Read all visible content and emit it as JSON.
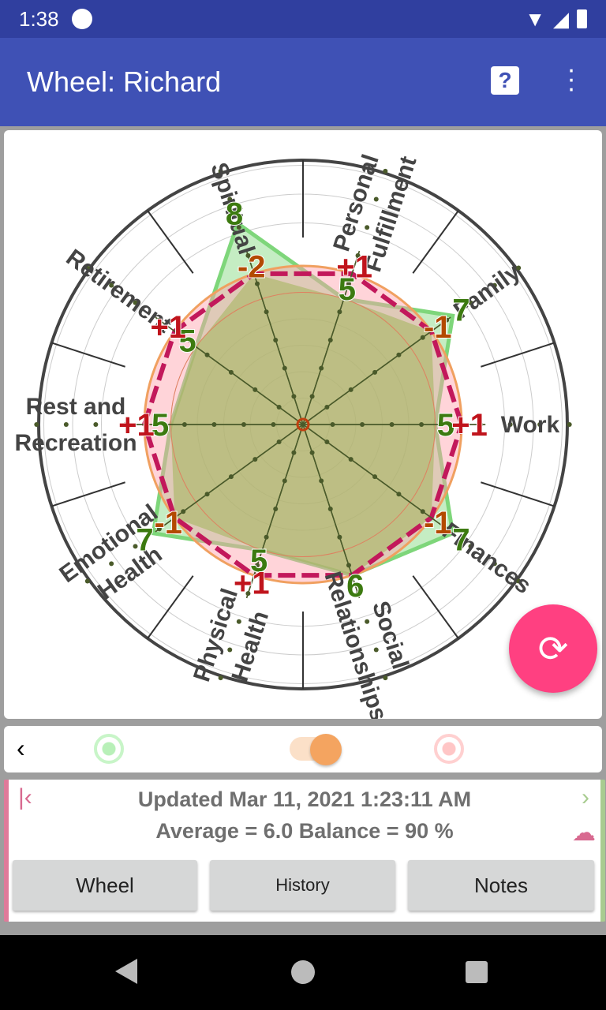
{
  "status_bar": {
    "time": "1:38"
  },
  "app_bar": {
    "title": "Wheel: Richard",
    "help_icon": "help-icon",
    "more_icon": "more-vert-icon"
  },
  "colors": {
    "primary": "#3f51b5",
    "accent": "#ff4081",
    "current": "#3c8a14",
    "target": "#c2185b",
    "delta_negative": "#b34a00",
    "delta_positive": "#c0141c"
  },
  "chart_data": {
    "type": "radar",
    "categories": [
      [
        "Work"
      ],
      [
        "Family"
      ],
      [
        "Personal",
        "Fulfillment"
      ],
      [
        "Spiritual"
      ],
      [
        "Retirement"
      ],
      [
        "Rest and",
        "Recreation"
      ],
      [
        "Emotional",
        "Health"
      ],
      [
        "Physical",
        "Health"
      ],
      [
        "Social",
        "Relationships"
      ],
      [
        "Finances"
      ]
    ],
    "rlim": [
      0,
      10
    ],
    "series": [
      {
        "values": [
          5,
          7,
          5,
          8,
          5,
          5,
          7,
          5,
          6,
          7
        ],
        "color": "#7ed67a"
      },
      {
        "values": [
          6,
          6,
          6,
          6,
          6,
          6,
          6,
          6,
          6,
          6
        ],
        "color": "#c2185b",
        "style": "dashed"
      }
    ],
    "value_labels": [
      "5",
      "7",
      "5",
      "8",
      "5",
      "5",
      "7",
      "5",
      "6",
      "7"
    ],
    "delta_labels": [
      "+1",
      "-1",
      "+1",
      "-2",
      "+1",
      "+1",
      "-1",
      "+1",
      "",
      "-1"
    ]
  },
  "controls": {
    "back_icon": "chevron-left-icon"
  },
  "info": {
    "updated": "Updated Mar 11, 2021 1:23:11 AM",
    "summary": "Average = 6.0 Balance = 90 %"
  },
  "buttons": {
    "wheel": "Wheel",
    "history": "History",
    "notes": "Notes"
  }
}
